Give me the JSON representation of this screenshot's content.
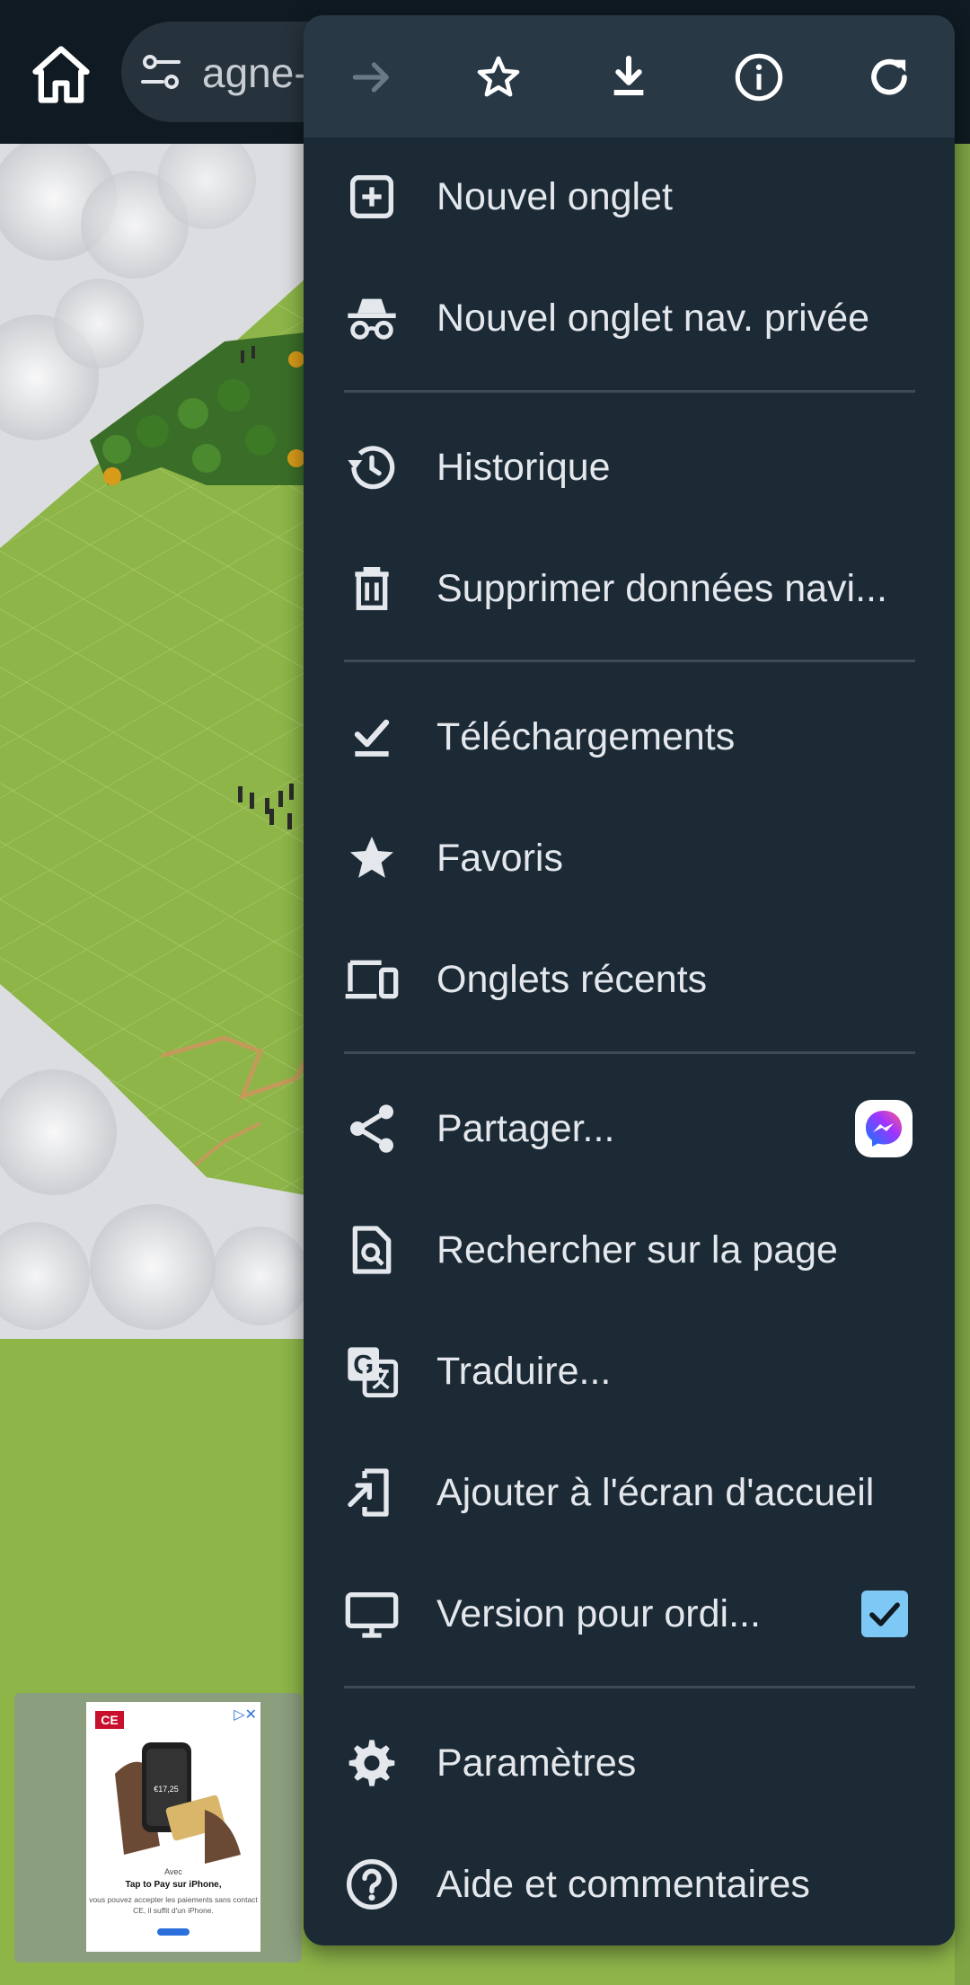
{
  "browser": {
    "url_text": "agne-",
    "icons": {
      "home": "home-icon",
      "site_settings": "tune-icon"
    }
  },
  "menu": {
    "toolbar": [
      {
        "name": "forward-icon",
        "enabled": false
      },
      {
        "name": "star-icon"
      },
      {
        "name": "download-icon"
      },
      {
        "name": "info-icon"
      },
      {
        "name": "refresh-icon"
      }
    ],
    "items": [
      {
        "label": "Nouvel onglet",
        "icon": "new-tab-icon"
      },
      {
        "label": "Nouvel onglet nav. privée",
        "icon": "incognito-icon"
      },
      {
        "label": "Historique",
        "icon": "history-icon"
      },
      {
        "label": "Supprimer données navi...",
        "icon": "trash-icon"
      },
      {
        "label": "Téléchargements",
        "icon": "downloads-check-icon"
      },
      {
        "label": "Favoris",
        "icon": "bookmark-star-icon"
      },
      {
        "label": "Onglets récents",
        "icon": "devices-icon"
      },
      {
        "label": "Partager...",
        "icon": "share-icon",
        "trailing": "messenger-icon"
      },
      {
        "label": "Rechercher sur la page",
        "icon": "find-in-page-icon"
      },
      {
        "label": "Traduire...",
        "icon": "translate-icon"
      },
      {
        "label": "Ajouter à l'écran d'accueil",
        "icon": "add-to-home-icon"
      },
      {
        "label": "Version pour ordi...",
        "icon": "desktop-icon",
        "checked": true
      },
      {
        "label": "Paramètres",
        "icon": "gear-icon"
      },
      {
        "label": "Aide et commentaires",
        "icon": "help-icon"
      }
    ]
  },
  "ad": {
    "brand": "CE",
    "headline_small": "Avec",
    "headline": "Tap to Pay sur iPhone,",
    "body": "vous pouvez accepter les paiements sans contact CE, il suffit d'un iPhone.",
    "phone_amount": "€17,25"
  },
  "colors": {
    "menu_bg": "#1c2a36",
    "toolbar_bg": "#283845",
    "text": "#e4e8ec",
    "checkbox": "#7ec8f5"
  }
}
